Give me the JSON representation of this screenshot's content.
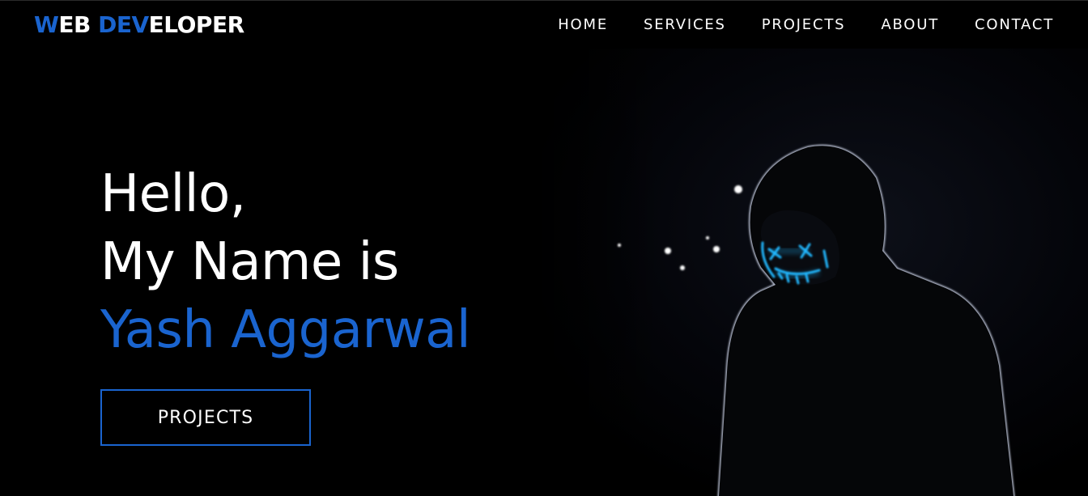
{
  "theme": {
    "accent": "#1a64cf",
    "mask_glow": "#23b8ff"
  },
  "logo": {
    "segments": [
      "W",
      "EB ",
      "DEV",
      "ELOPER"
    ]
  },
  "nav": {
    "items": [
      "HOME",
      "SERVICES",
      "PROJECTS",
      "ABOUT",
      "CONTACT"
    ]
  },
  "hero": {
    "line1": "Hello,",
    "line2": "My Name is",
    "name": "Yash Aggarwal",
    "button_label": "PROJECTS"
  }
}
